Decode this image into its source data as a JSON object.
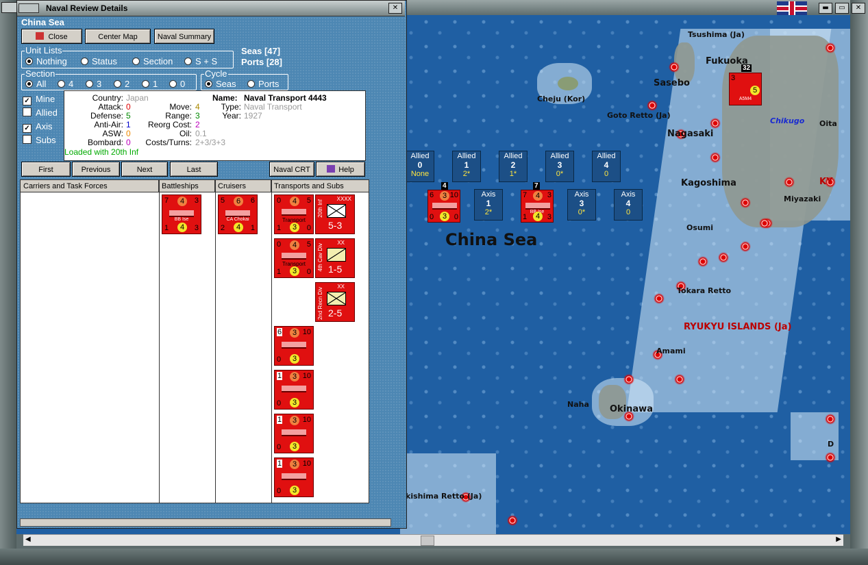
{
  "window": {
    "title": "Naval Review Details"
  },
  "sea": {
    "name": "China Sea"
  },
  "buttons": {
    "close": "Close",
    "center_map": "Center Map",
    "naval_summary": "Naval Summary",
    "first": "First",
    "previous": "Previous",
    "next": "Next",
    "last": "Last",
    "naval_crt": "Naval CRT",
    "help": "Help"
  },
  "unit_lists": {
    "label": "Unit Lists",
    "options": [
      "Nothing",
      "Status",
      "Section",
      "S + S"
    ],
    "selected": "Nothing"
  },
  "seas_count": "Seas [47]",
  "ports_count": "Ports [28]",
  "section": {
    "label": "Section",
    "options": [
      "All",
      "4",
      "3",
      "2",
      "1",
      "0"
    ],
    "selected": "All"
  },
  "cycle": {
    "label": "Cycle",
    "options": [
      "Seas",
      "Ports"
    ],
    "selected": "Seas"
  },
  "filters": [
    {
      "label": "Mine",
      "checked": true
    },
    {
      "label": "Allied",
      "checked": false
    },
    {
      "label": "Axis",
      "checked": true
    },
    {
      "label": "Subs",
      "checked": false
    }
  ],
  "unit_info": {
    "country_label": "Country:",
    "country": "Japan",
    "attack_label": "Attack:",
    "attack": "0",
    "defense_label": "Defense:",
    "defense": "5",
    "antiair_label": "Anti-Air:",
    "antiair": "1",
    "asw_label": "ASW:",
    "asw": "0",
    "bombard_label": "Bombard:",
    "bombard": "0",
    "move_label": "Move:",
    "move": "4",
    "range_label": "Range:",
    "range": "3",
    "reorg_label": "Reorg Cost:",
    "reorg": "2",
    "oil_label": "Oil:",
    "oil": "0.1",
    "costs_label": "Costs/Turns:",
    "costs": "2+3/3+3",
    "name_label": "Name:",
    "name": "Naval Transport 4443",
    "type_label": "Type:",
    "type": "Naval Transport",
    "year_label": "Year:",
    "year": "1927",
    "loaded": "Loaded with 20th Inf"
  },
  "columns": [
    "Carriers and Task Forces",
    "Battleships",
    "Cruisers",
    "Transports and Subs"
  ],
  "battleships": [
    {
      "tl": "7",
      "tc": "4",
      "tr": "3",
      "cap": "BB Ise",
      "bl": "1",
      "bc": "4",
      "br": "3"
    }
  ],
  "cruisers": [
    {
      "tl": "5",
      "tc": "6",
      "tr": "6",
      "cap": "CA Chokai",
      "bl": "2",
      "bc": "4",
      "br": "1"
    }
  ],
  "transports": [
    {
      "tl": "0",
      "tc": "4",
      "tr": "5",
      "cap": "Transport",
      "bl": "1",
      "bc": "3",
      "br": "0"
    },
    {
      "tl": "0",
      "tc": "4",
      "tr": "5",
      "cap": "Transport",
      "bl": "1",
      "bc": "3",
      "br": "0"
    },
    {
      "tl": "6",
      "tc": "3",
      "tr": "10",
      "cap": "",
      "bl": "0",
      "bc": "3",
      "br": "0"
    },
    {
      "tl": "1",
      "tc": "3",
      "tr": "10",
      "cap": "",
      "bl": "0",
      "bc": "3",
      "br": "0"
    },
    {
      "tl": "1",
      "tc": "3",
      "tr": "10",
      "cap": "",
      "bl": "0",
      "bc": "3",
      "br": "0"
    },
    {
      "tl": "1",
      "tc": "3",
      "tr": "10",
      "cap": "",
      "bl": "0",
      "bc": "3",
      "br": "0"
    }
  ],
  "land_units": [
    {
      "size": "XXXX",
      "side": "20th Inf",
      "value": "5-3"
    },
    {
      "size": "XX",
      "side": "4th Cav Div",
      "value": "1-5"
    },
    {
      "size": "XX",
      "side": "2nd Recn Div",
      "value": "2-5"
    }
  ],
  "allied_boxes": [
    {
      "side": "Allied",
      "num": "0",
      "sub": "None"
    },
    {
      "side": "Allied",
      "num": "1",
      "sub": "2*"
    },
    {
      "side": "Allied",
      "num": "2",
      "sub": "1*"
    },
    {
      "side": "Allied",
      "num": "3",
      "sub": "0*"
    },
    {
      "side": "Allied",
      "num": "4",
      "sub": "0"
    }
  ],
  "axis_boxes": [
    {
      "side": "Axis",
      "num": "1",
      "sub": "2*"
    },
    {
      "side": "Axis",
      "num": "3",
      "sub": "0*"
    },
    {
      "side": "Axis",
      "num": "4",
      "sub": "0"
    }
  ],
  "map_counters": [
    {
      "stack": "4",
      "tl": "6",
      "tc": "3",
      "tr": "10",
      "bl": "0",
      "bc": "3",
      "br": "0"
    },
    {
      "stack": "7",
      "tl": "7",
      "tc": "4",
      "tr": "3",
      "bl": "1",
      "bc": "4",
      "br": "3",
      "cap": "BB Ise"
    },
    {
      "stack": "32",
      "tl": "3",
      "tc": "",
      "tr": "",
      "bl": "",
      "bc": "5",
      "br": "",
      "cap": "A5M4"
    }
  ],
  "map_labels": {
    "china_sea": "China Sea",
    "tsushima": "Tsushima (Ja)",
    "fukuoka": "Fukuoka",
    "sasebo": "Sasebo",
    "cheju": "Cheju (Kor)",
    "goto": "Goto Retto (Ja)",
    "nagasaki": "Nagasaki",
    "chikugo": "Chikugo",
    "oita": "Oita",
    "kagoshima": "Kagoshima",
    "ky": "KY",
    "miyazaki": "Miyazaki",
    "osumi": "Osumi",
    "tokara": "Tokara Retto",
    "ryukyu": "RYUKYU ISLANDS (Ja)",
    "amami": "Amami",
    "naha": "Naha",
    "okinawa": "Okinawa",
    "kishima": "kishima Retto (Ja)",
    "d": "D"
  },
  "colors": {
    "dialog_bg": "#4d87b3",
    "sea": "#1f5fa3",
    "unit_red": "#e01010",
    "allied_box": "#1c4f86"
  }
}
